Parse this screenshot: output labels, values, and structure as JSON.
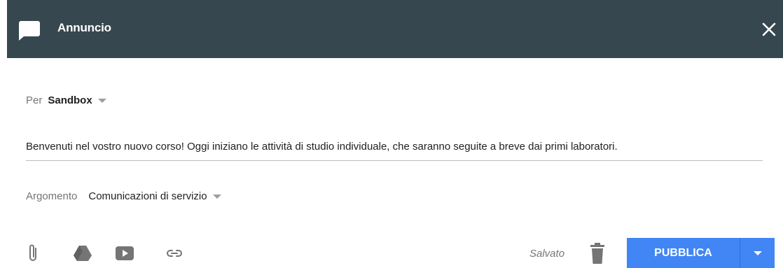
{
  "header": {
    "title": "Annuncio",
    "icon": "announcement-icon",
    "close_icon": "close-icon",
    "color": "#37474f"
  },
  "audience": {
    "label": "Per",
    "class_name": "Sandbox"
  },
  "message": {
    "text": "Benvenuti nel vostro nuovo corso! Oggi iniziano le attività di studio individuale, che saranno seguite a breve dai primi laboratori."
  },
  "topic": {
    "label": "Argomento",
    "value": "Comunicazioni di servizio"
  },
  "toolbar": {
    "icons": [
      "paperclip-icon",
      "google-drive-icon",
      "youtube-icon",
      "link-icon"
    ],
    "status": "Salvato",
    "delete_icon": "trash-icon",
    "publish_label": "PUBBLICA",
    "accent": "#4285f4"
  }
}
